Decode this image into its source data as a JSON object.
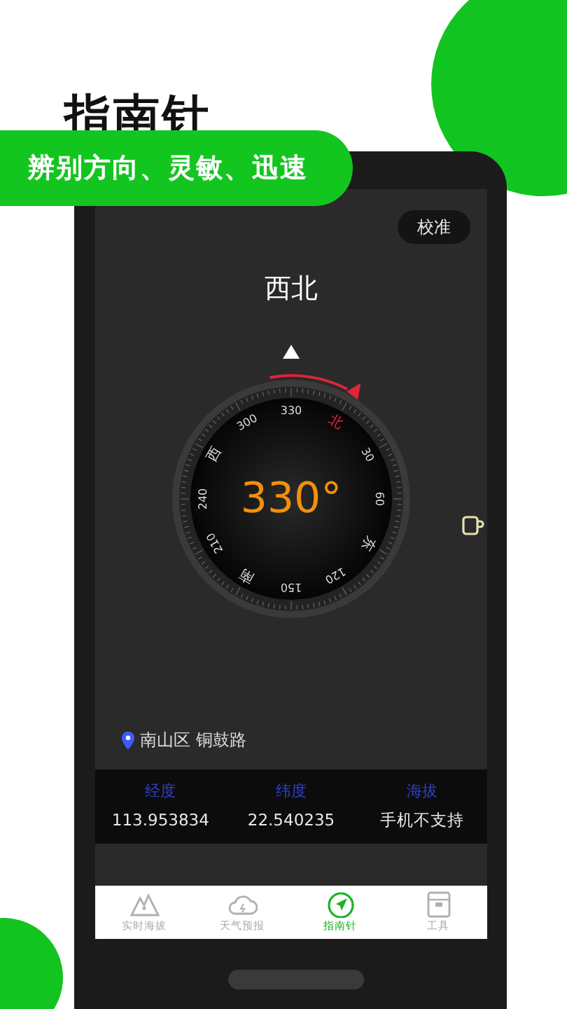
{
  "promo": {
    "title": "指南针",
    "tagline": "辨别方向、灵敏、迅速"
  },
  "calibrate_button": "校准",
  "direction": "西北",
  "compass": {
    "heading": "330°",
    "dial_labels": [
      {
        "text": "330",
        "color": "#dddddd"
      },
      {
        "text": "北",
        "color": "#e0243c"
      },
      {
        "text": "30",
        "color": "#dddddd"
      },
      {
        "text": "60",
        "color": "#dddddd"
      },
      {
        "text": "东",
        "color": "#dddddd"
      },
      {
        "text": "120",
        "color": "#dddddd"
      },
      {
        "text": "150",
        "color": "#dddddd"
      },
      {
        "text": "南",
        "color": "#dddddd"
      },
      {
        "text": "210",
        "color": "#dddddd"
      },
      {
        "text": "240",
        "color": "#dddddd"
      },
      {
        "text": "西",
        "color": "#dddddd"
      },
      {
        "text": "300",
        "color": "#dddddd"
      }
    ]
  },
  "location": "南山区 铜鼓路",
  "info": [
    {
      "label": "经度",
      "value": "113.953834"
    },
    {
      "label": "纬度",
      "value": "22.540235"
    },
    {
      "label": "海拔",
      "value": "手机不支持"
    }
  ],
  "tabs": [
    {
      "kind": "mountain",
      "label": "实时海拔",
      "selected": false
    },
    {
      "kind": "weather",
      "label": "天气预报",
      "selected": false
    },
    {
      "kind": "compass",
      "label": "指南针",
      "selected": true
    },
    {
      "kind": "tools",
      "label": "工具",
      "selected": false
    }
  ]
}
